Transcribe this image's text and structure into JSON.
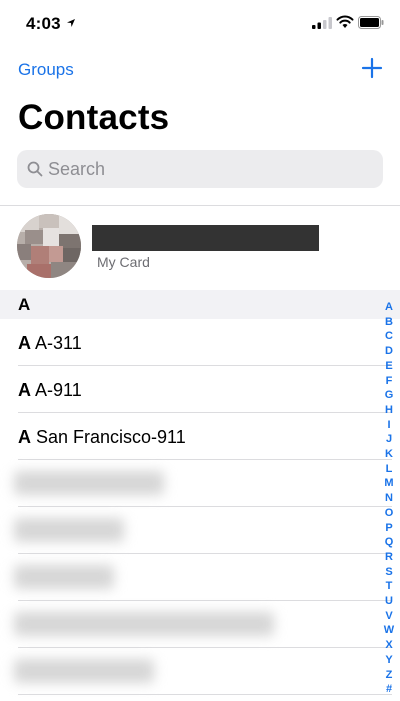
{
  "status_bar": {
    "time": "4:03"
  },
  "nav": {
    "groups_label": "Groups",
    "add_icon": "plus-icon",
    "title": "Contacts"
  },
  "search": {
    "placeholder": "Search"
  },
  "my_card": {
    "subtitle": "My Card"
  },
  "section": {
    "letter": "A"
  },
  "contacts": [
    {
      "bold": "A",
      "rest": " A-311"
    },
    {
      "bold": "A",
      "rest": " A-911"
    },
    {
      "bold": "A",
      "rest": " San Francisco-911"
    }
  ],
  "index": [
    "A",
    "B",
    "C",
    "D",
    "E",
    "F",
    "G",
    "H",
    "I",
    "J",
    "K",
    "L",
    "M",
    "N",
    "O",
    "P",
    "Q",
    "R",
    "S",
    "T",
    "U",
    "V",
    "W",
    "X",
    "Y",
    "Z",
    "#"
  ],
  "colors": {
    "accent": "#1a73e8"
  }
}
